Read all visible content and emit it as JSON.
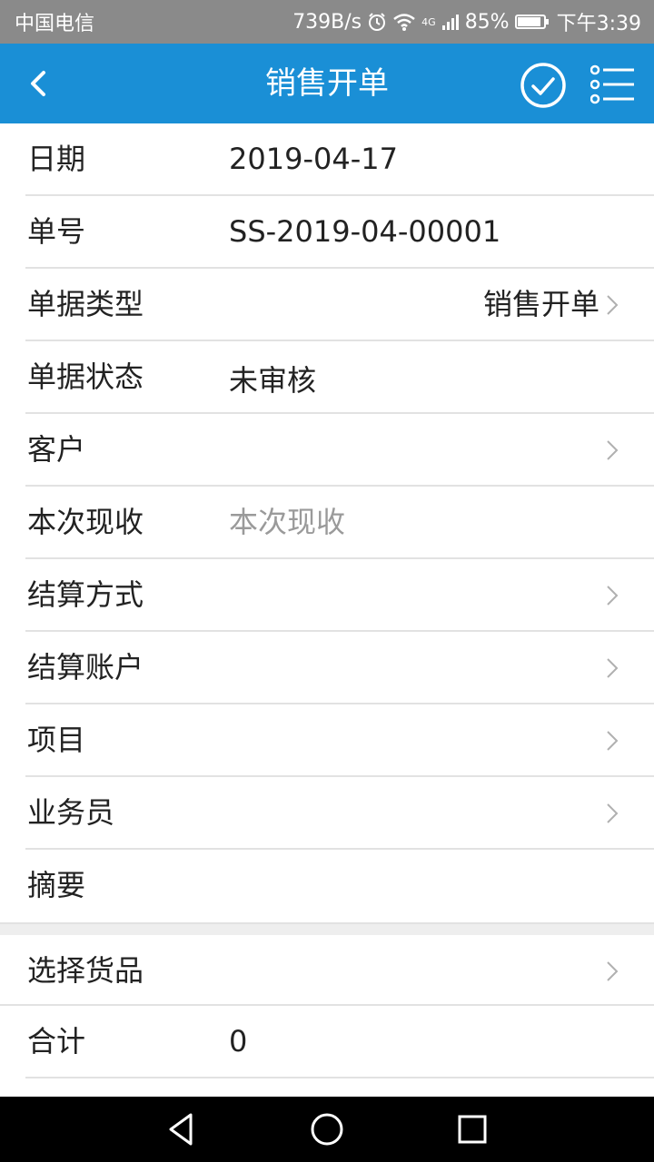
{
  "status_bar": {
    "carrier": "中国电信",
    "speed": "739B/s",
    "network": "4G",
    "battery": "85%",
    "battery_level": 0.85,
    "time": "下午3:39"
  },
  "app_bar": {
    "title": "销售开单",
    "icons": [
      "back-icon",
      "confirm-check-icon",
      "list-menu-icon"
    ],
    "color": "#1a8fd6"
  },
  "form": {
    "date": {
      "label": "日期",
      "value": "2019-04-17"
    },
    "number": {
      "label": "单号",
      "value": "SS-2019-04-00001"
    },
    "doc_type": {
      "label": "单据类型",
      "value": "销售开单"
    },
    "doc_status": {
      "label": "单据状态",
      "value": "未审核"
    },
    "customer": {
      "label": "客户",
      "value": ""
    },
    "received": {
      "label": "本次现收",
      "placeholder": "本次现收"
    },
    "settle_method": {
      "label": "结算方式",
      "value": ""
    },
    "settle_account": {
      "label": "结算账户",
      "value": ""
    },
    "project": {
      "label": "项目",
      "value": ""
    },
    "salesperson": {
      "label": "业务员",
      "value": ""
    },
    "summary": {
      "label": "摘要",
      "value": ""
    }
  },
  "goods": {
    "select": {
      "label": "选择货品"
    },
    "total": {
      "label": "合计",
      "value": "0"
    }
  },
  "nav_bar": {
    "icons": [
      "back-triangle-icon",
      "home-circle-icon",
      "recents-square-icon"
    ]
  }
}
